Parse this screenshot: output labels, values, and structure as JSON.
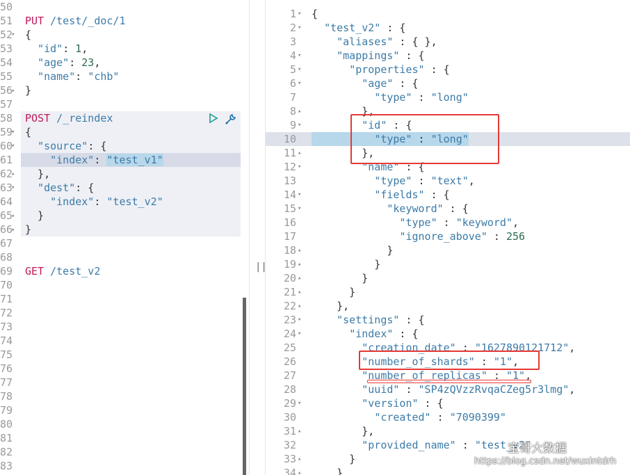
{
  "left_editor": {
    "lines": [
      {
        "n": "50",
        "t": "",
        "f": ""
      },
      {
        "n": "51",
        "t": "PUT /test/_doc/1",
        "f": ""
      },
      {
        "n": "52",
        "t": "{",
        "f": "▾"
      },
      {
        "n": "53",
        "t": "  \"id\": 1,",
        "f": ""
      },
      {
        "n": "54",
        "t": "  \"age\": 23,",
        "f": ""
      },
      {
        "n": "55",
        "t": "  \"name\": \"chb\"",
        "f": ""
      },
      {
        "n": "56",
        "t": "}",
        "f": "▴"
      },
      {
        "n": "57",
        "t": "",
        "f": ""
      },
      {
        "n": "58",
        "t": "POST /_reindex",
        "f": ""
      },
      {
        "n": "59",
        "t": "{",
        "f": "▾"
      },
      {
        "n": "60",
        "t": "  \"source\": {",
        "f": "▾"
      },
      {
        "n": "61",
        "t": "    \"index\": \"test_v1\"",
        "f": ""
      },
      {
        "n": "62",
        "t": "  },",
        "f": "▴"
      },
      {
        "n": "63",
        "t": "  \"dest\": {",
        "f": "▾"
      },
      {
        "n": "64",
        "t": "    \"index\": \"test_v2\"",
        "f": ""
      },
      {
        "n": "65",
        "t": "  }",
        "f": "▴"
      },
      {
        "n": "66",
        "t": "}",
        "f": "▴"
      },
      {
        "n": "67",
        "t": "",
        "f": ""
      },
      {
        "n": "68",
        "t": "",
        "f": ""
      },
      {
        "n": "69",
        "t": "GET /test_v2",
        "f": ""
      },
      {
        "n": "70",
        "t": "",
        "f": ""
      },
      {
        "n": "71",
        "t": "",
        "f": ""
      },
      {
        "n": "72",
        "t": "",
        "f": ""
      },
      {
        "n": "73",
        "t": "",
        "f": ""
      },
      {
        "n": "74",
        "t": "",
        "f": ""
      },
      {
        "n": "75",
        "t": "",
        "f": ""
      },
      {
        "n": "76",
        "t": "",
        "f": ""
      },
      {
        "n": "77",
        "t": "",
        "f": ""
      },
      {
        "n": "78",
        "t": "",
        "f": ""
      },
      {
        "n": "79",
        "t": "",
        "f": ""
      },
      {
        "n": "80",
        "t": "",
        "f": ""
      },
      {
        "n": "81",
        "t": "",
        "f": ""
      },
      {
        "n": "82",
        "t": "",
        "f": ""
      },
      {
        "n": "83",
        "t": "",
        "f": ""
      }
    ]
  },
  "right_editor": {
    "lines": [
      {
        "n": "1",
        "t": "{",
        "f": "▾"
      },
      {
        "n": "2",
        "t": "  \"test_v2\" : {",
        "f": "▾"
      },
      {
        "n": "3",
        "t": "    \"aliases\" : { },",
        "f": ""
      },
      {
        "n": "4",
        "t": "    \"mappings\" : {",
        "f": "▾"
      },
      {
        "n": "5",
        "t": "      \"properties\" : {",
        "f": "▾"
      },
      {
        "n": "6",
        "t": "        \"age\" : {",
        "f": "▾"
      },
      {
        "n": "7",
        "t": "          \"type\" : \"long\"",
        "f": ""
      },
      {
        "n": "8",
        "t": "        },",
        "f": "▴"
      },
      {
        "n": "9",
        "t": "        \"id\" : {",
        "f": "▾"
      },
      {
        "n": "10",
        "t": "          \"type\" : \"long\"",
        "f": ""
      },
      {
        "n": "11",
        "t": "        },",
        "f": "▴"
      },
      {
        "n": "12",
        "t": "        \"name\" : {",
        "f": "▾"
      },
      {
        "n": "13",
        "t": "          \"type\" : \"text\",",
        "f": ""
      },
      {
        "n": "14",
        "t": "          \"fields\" : {",
        "f": "▾"
      },
      {
        "n": "15",
        "t": "            \"keyword\" : {",
        "f": "▾"
      },
      {
        "n": "16",
        "t": "              \"type\" : \"keyword\",",
        "f": ""
      },
      {
        "n": "17",
        "t": "              \"ignore_above\" : 256",
        "f": ""
      },
      {
        "n": "18",
        "t": "            }",
        "f": "▴"
      },
      {
        "n": "19",
        "t": "          }",
        "f": "▴"
      },
      {
        "n": "20",
        "t": "        }",
        "f": "▴"
      },
      {
        "n": "21",
        "t": "      }",
        "f": "▴"
      },
      {
        "n": "22",
        "t": "    },",
        "f": "▴"
      },
      {
        "n": "23",
        "t": "    \"settings\" : {",
        "f": "▾"
      },
      {
        "n": "24",
        "t": "      \"index\" : {",
        "f": "▾"
      },
      {
        "n": "25",
        "t": "        \"creation_date\" : \"1627890121712\",",
        "f": ""
      },
      {
        "n": "26",
        "t": "        \"number_of_shards\" : \"1\",",
        "f": ""
      },
      {
        "n": "27",
        "t": "        \"number_of_replicas\" : \"1\",",
        "f": ""
      },
      {
        "n": "28",
        "t": "        \"uuid\" : \"SP4zQVzzRvqaCZeg5r3lmg\",",
        "f": ""
      },
      {
        "n": "29",
        "t": "        \"version\" : {",
        "f": "▾"
      },
      {
        "n": "30",
        "t": "          \"created\" : \"7090399\"",
        "f": ""
      },
      {
        "n": "31",
        "t": "        },",
        "f": "▴"
      },
      {
        "n": "32",
        "t": "        \"provided_name\" : \"test_v2\"",
        "f": ""
      },
      {
        "n": "33",
        "t": "      }",
        "f": "▴"
      },
      {
        "n": "34",
        "t": "    }",
        "f": "▴"
      }
    ]
  },
  "toolbar": {
    "run_icon": "play-icon",
    "settings_icon": "wrench-icon",
    "resize_glyph": "||"
  },
  "watermark": {
    "brand": "宝哥大数据",
    "url": "https://blog.csdn.net/wuxintdrh"
  }
}
